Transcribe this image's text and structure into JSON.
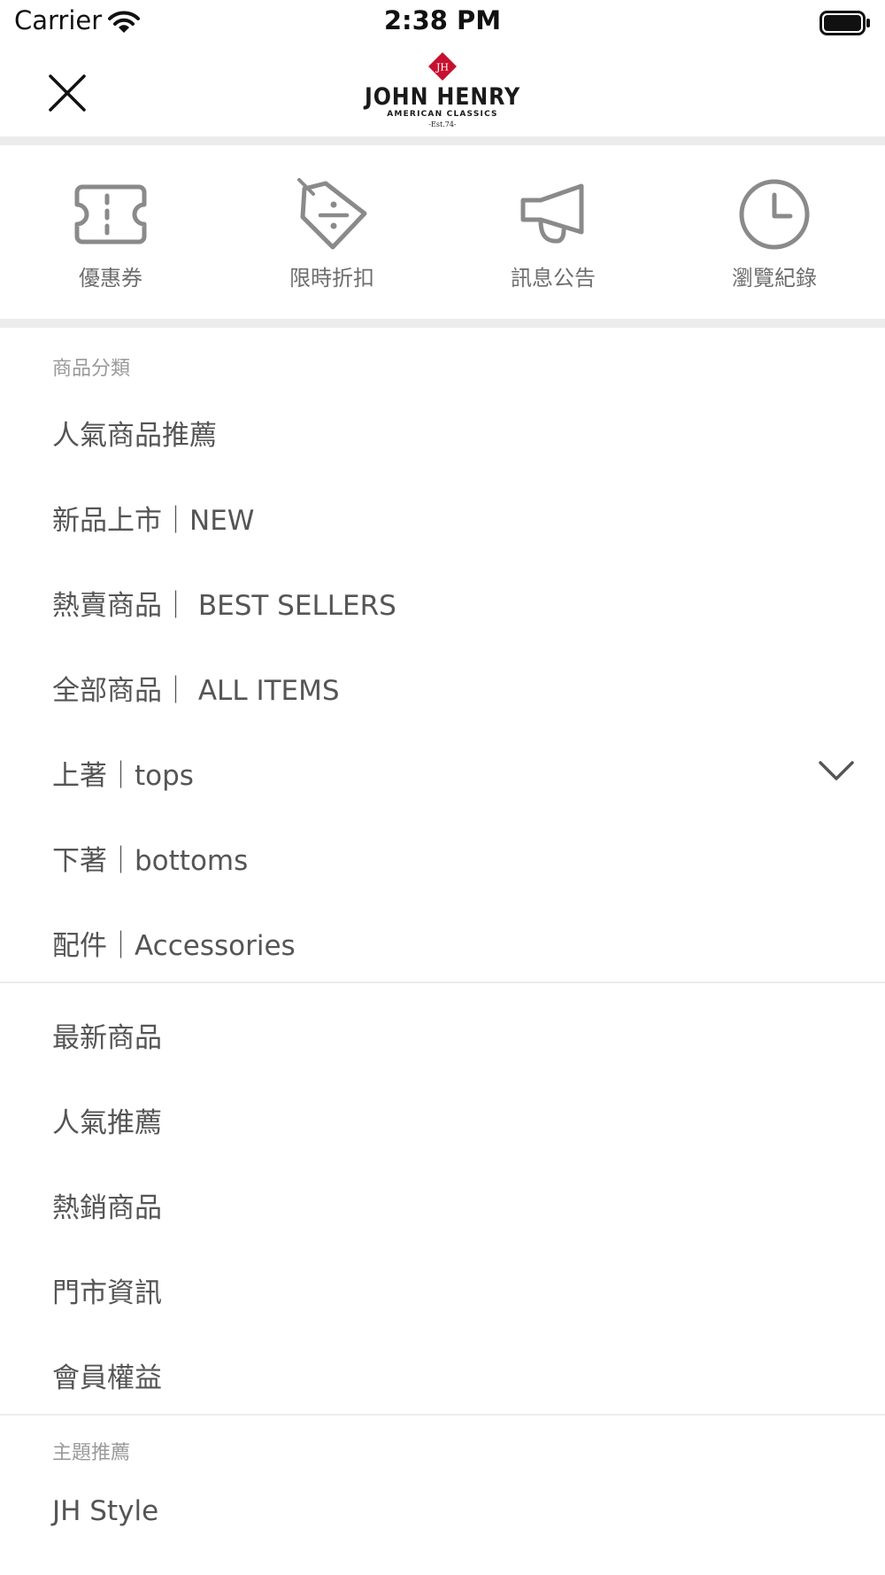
{
  "status_bar": {
    "carrier": "Carrier",
    "time": "2:38 PM"
  },
  "header": {
    "logo": {
      "monogram": "JH",
      "brand": "JOHN HENRY",
      "subtitle": "AMERICAN CLASSICS",
      "est": "-Est.74-"
    },
    "close_icon": "close-icon"
  },
  "shortcuts": [
    {
      "label": "優惠券",
      "icon": "ticket-icon"
    },
    {
      "label": "限時折扣",
      "icon": "discount-tag-icon"
    },
    {
      "label": "訊息公告",
      "icon": "megaphone-icon"
    },
    {
      "label": "瀏覽紀錄",
      "icon": "clock-icon"
    }
  ],
  "categories": {
    "title": "商品分類",
    "items": [
      {
        "label": "人氣商品推薦"
      },
      {
        "label": "新品上市｜NEW"
      },
      {
        "label": "熱賣商品｜ BEST SELLERS"
      },
      {
        "label": "全部商品｜ ALL ITEMS"
      },
      {
        "label": "上著｜tops",
        "expandable": true
      },
      {
        "label": "下著｜bottoms"
      },
      {
        "label": "配件｜Accessories"
      }
    ]
  },
  "links": {
    "items": [
      {
        "label": "最新商品"
      },
      {
        "label": "人氣推薦"
      },
      {
        "label": "熱銷商品"
      },
      {
        "label": "門市資訊"
      },
      {
        "label": "會員權益"
      }
    ]
  },
  "themes": {
    "title": "主題推薦",
    "items": [
      {
        "label": "JH Style"
      }
    ]
  },
  "colors": {
    "logo_red": "#c8102e",
    "icon_gray": "#8a8a8a",
    "divider": "#ececec"
  }
}
